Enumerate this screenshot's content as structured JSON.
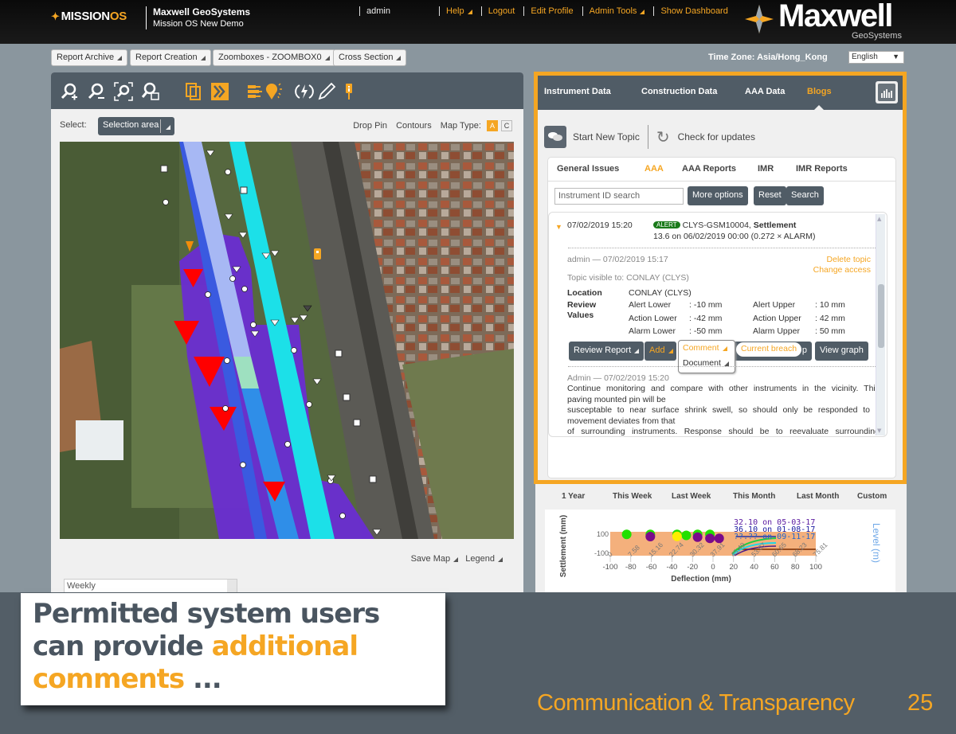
{
  "header": {
    "app_logo": "MISSIONOS",
    "app_logo_main": "MISSION",
    "app_logo_suffix": "OS",
    "org_name": "Maxwell GeoSystems",
    "project_name": "Mission OS New Demo",
    "user": "admin",
    "nav_links": [
      {
        "label": "Help",
        "has_menu": true
      },
      {
        "label": "Logout",
        "has_menu": false
      },
      {
        "label": "Edit Profile",
        "has_menu": false
      },
      {
        "label": "Admin Tools",
        "has_menu": true
      },
      {
        "label": "Show Dashboard",
        "has_menu": false
      }
    ],
    "brand_name": "Maxwell",
    "brand_sub": "GeoSystems"
  },
  "subbar": {
    "buttons": [
      "Report Archive",
      "Report Creation",
      "Zoomboxes - ZOOMBOX0",
      "Cross Section"
    ],
    "timezone": "Time Zone: Asia/Hong_Kong",
    "language": "English"
  },
  "map_panel": {
    "tools": [
      "zoom-in",
      "zoom-out",
      "zoom-extent",
      "zoom-box",
      "layers",
      "forward",
      "legend-list",
      "light-bulb",
      "lightning",
      "pencil",
      "pin"
    ],
    "select_label": "Select:",
    "select_value": "Selection area",
    "links": [
      "Drop Pin",
      "Contours"
    ],
    "map_type_label": "Map Type:",
    "map_types": [
      {
        "label": "A",
        "active": true
      },
      {
        "label": "C",
        "active": false
      }
    ],
    "save_map": "Save Map",
    "legend": "Legend",
    "period_select": "Weekly"
  },
  "blog_panel": {
    "tabs": [
      {
        "label": "Instrument Data",
        "active": false
      },
      {
        "label": "Construction Data",
        "active": false
      },
      {
        "label": "AAA Data",
        "active": false
      },
      {
        "label": "Blogs",
        "active": true
      }
    ],
    "start_new_topic": "Start New Topic",
    "check_updates": "Check for updates",
    "subtabs": [
      {
        "label": "General Issues",
        "active": false
      },
      {
        "label": "AAA",
        "active": true
      },
      {
        "label": "AAA Reports",
        "active": false
      },
      {
        "label": "IMR",
        "active": false
      },
      {
        "label": "IMR Reports",
        "active": false
      }
    ],
    "search_placeholder": "Instrument ID search",
    "more_options": "More options",
    "reset": "Reset",
    "search": "Search",
    "entry": {
      "datetime": "07/02/2019 15:20",
      "badge": "ALERT",
      "instrument": "CLYS-GSM10004,",
      "type": "Settlement",
      "reading": "13.6 on 06/02/2019 00:00 (0.272 × ALARM)",
      "author_line": "admin — 07/02/2019 15:17",
      "delete_topic": "Delete topic",
      "change_access": "Change access",
      "visible_to": "Topic visible to: CONLAY (CLYS)",
      "location_label": "Location",
      "location_value": "CONLAY (CLYS)",
      "review_label": "Review Values",
      "review_values": [
        {
          "label": "Alert Lower",
          "value": ": -10 mm",
          "label2": "Alert Upper",
          "value2": ": 10 mm"
        },
        {
          "label": "Action Lower",
          "value": ": -42 mm",
          "label2": "Action Upper",
          "value2": ": 42 mm"
        },
        {
          "label": "Alarm Lower",
          "value": ": -50 mm",
          "label2": "Alarm Upper",
          "value2": ": 50 mm"
        }
      ],
      "buttons": {
        "review_report": "Review Report",
        "add": "Add",
        "hidden_fragment": "p",
        "view_graph": "View graph"
      },
      "add_menu": [
        "Comment",
        "Document"
      ],
      "tooltip": "Current breach",
      "comment_author": "Admin — 07/02/2019 15:20",
      "comment_lines": [
        "Continue monitoring and compare with other instruments in the vicinity. This",
        "paving mounted pin will be",
        "susceptable to near surface shrink swell, so should only be responded to if",
        "movement deviates from that",
        "of surrounding instruments. Response should be to reevaluate surrounding"
      ]
    }
  },
  "chart_panel": {
    "ranges": [
      "1 Year",
      "This Week",
      "Last Week",
      "This Month",
      "Last Month",
      "Custom"
    ]
  },
  "chart_data": {
    "type": "scatter",
    "title": "",
    "xlabel": "Deflection (mm)",
    "ylabel": "Settlement (mm)",
    "y2label": "Level (m)",
    "xlim": [
      -100,
      100
    ],
    "ylim": [
      -100,
      100
    ],
    "x_ticks": [
      "-100",
      "-80",
      "-60",
      "-40",
      "-20",
      "0",
      "20",
      "40",
      "60",
      "80",
      "100"
    ],
    "x2_ticks": [
      "0",
      "7.58",
      "15.16",
      "22.74",
      "30.32",
      "37.91",
      "45.49",
      "53.07",
      "60.65",
      "68.23",
      "75.81"
    ],
    "y_ticks": [
      "100",
      "-100"
    ],
    "annotations": [
      "32.10 on 05-03-17",
      "36.10 on 01-08-17",
      "??.?? on 09-11-17"
    ],
    "series": [
      {
        "name": "green",
        "color": "#22e000",
        "points": [
          [
            -84,
            78
          ],
          [
            -61,
            78
          ],
          [
            -35,
            78
          ],
          [
            -26,
            70
          ],
          [
            -15,
            78
          ],
          [
            -3,
            78
          ]
        ]
      },
      {
        "name": "purple",
        "color": "#7a0a8a",
        "points": [
          [
            -61,
            60
          ],
          [
            -15,
            55
          ],
          [
            -3,
            45
          ],
          [
            6,
            45
          ]
        ]
      },
      {
        "name": "yellow",
        "color": "#ffee00",
        "points": [
          [
            -35,
            62
          ]
        ]
      }
    ]
  },
  "slide": {
    "callout_line1": "Permitted system users",
    "callout_line2a": "can provide ",
    "callout_line2b": "additional",
    "callout_line3a": "comments",
    "callout_line3b": " ...",
    "footer": "Communication & Transparency",
    "page_number": "25"
  }
}
